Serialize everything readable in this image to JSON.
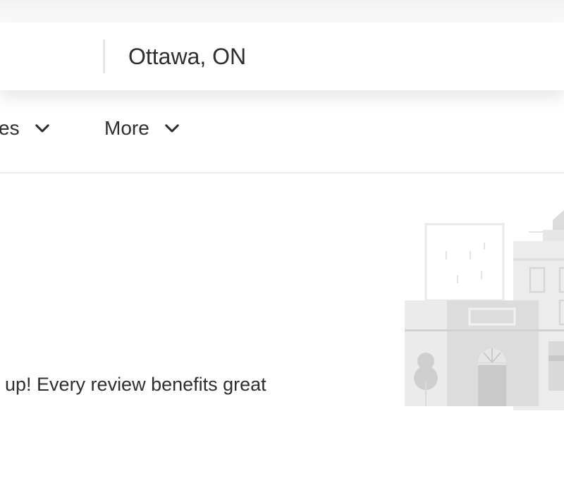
{
  "search": {
    "location_value": "Ottawa, ON"
  },
  "filters": {
    "left_partial_label": "es",
    "more_label": "More"
  },
  "content": {
    "heading_fragment": "!",
    "body_text": "t up! Every review benefits great"
  },
  "icons": {
    "filter_chevron": "chevron-down-icon",
    "more_chevron": "chevron-down-icon",
    "illustration": "storefront-illustration"
  },
  "colors": {
    "text": "#2d2e2f",
    "divider": "#ebebeb",
    "illustration_light": "#e8e8e8",
    "illustration_mid": "#d6d6d6"
  }
}
